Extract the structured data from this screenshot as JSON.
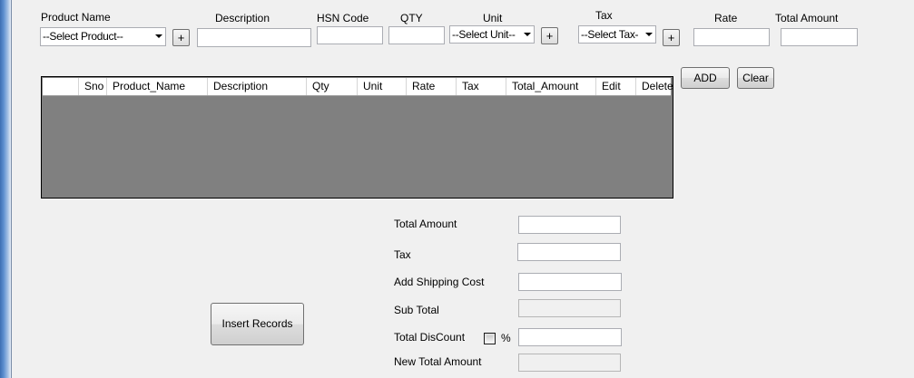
{
  "form": {
    "product_name_label": "Product Name",
    "description_label": "Description",
    "hsn_label": "HSN Code",
    "qty_label": "QTY",
    "unit_label": "Unit",
    "tax_label": "Tax",
    "rate_label": "Rate",
    "total_amount_label": "Total Amount",
    "product_select": "--Select Product--",
    "unit_select": "--Select Unit--",
    "tax_select": "--Select Tax-",
    "plus": "+",
    "add_button": "ADD",
    "clear_button": "Clear"
  },
  "grid": {
    "columns": [
      "Sno",
      "Product_Name",
      "Description",
      "Qty",
      "Unit",
      "Rate",
      "Tax",
      "Total_Amount",
      "Edit",
      "Delete"
    ]
  },
  "summary": {
    "total_amount_label": "Total Amount",
    "tax_label": "Tax",
    "shipping_label": "Add Shipping Cost",
    "subtotal_label": "Sub Total",
    "discount_label": "Total DisCount",
    "percent_label": "%",
    "new_total_label": "New Total Amount",
    "insert_button": "Insert Records"
  }
}
